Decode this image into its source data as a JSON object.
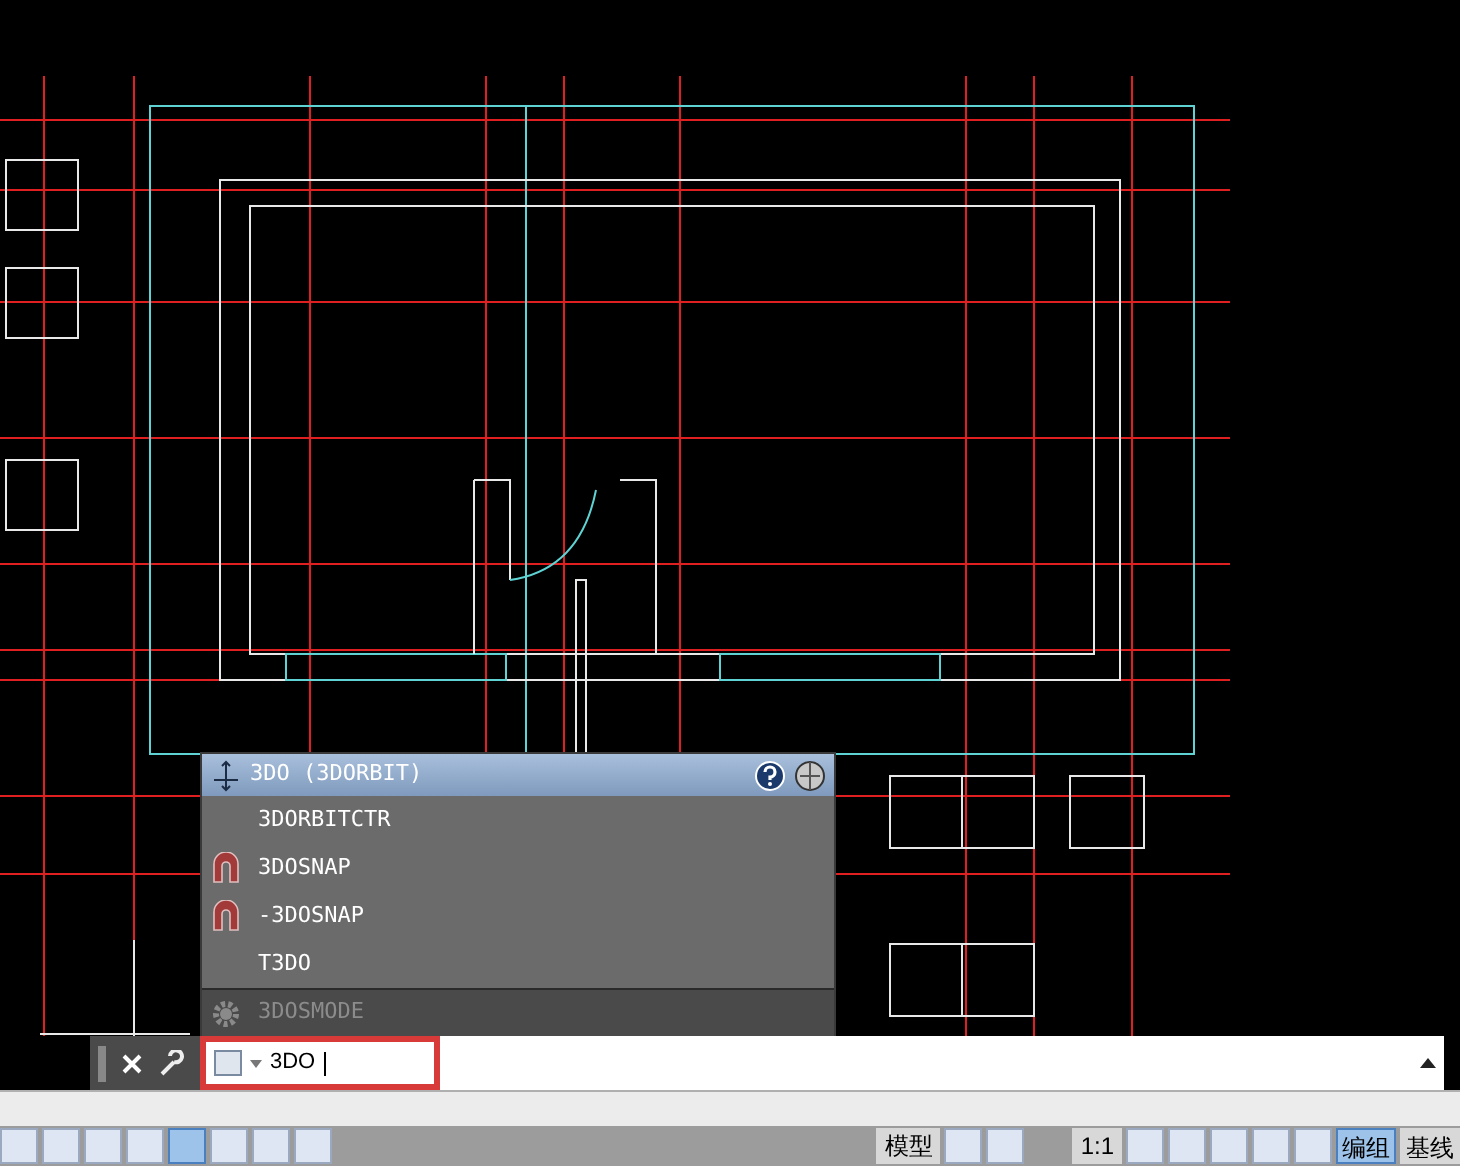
{
  "autocomplete": {
    "title": "3DO (3DORBIT)",
    "items": [
      {
        "label": "3DORBITCTR",
        "kind": "plain"
      },
      {
        "label": "3DOSNAP",
        "kind": "magnet"
      },
      {
        "label": "-3DOSNAP",
        "kind": "magnet"
      },
      {
        "label": "T3DO",
        "kind": "plain"
      },
      {
        "label": "3DOSMODE",
        "kind": "setting"
      }
    ]
  },
  "command_line": {
    "value": "3DO"
  },
  "status_bar": {
    "model_label": "模型",
    "scale": "1:1",
    "buttons": [
      {
        "label": "编组",
        "on": true
      },
      {
        "label": "基线",
        "on": false
      }
    ]
  }
}
